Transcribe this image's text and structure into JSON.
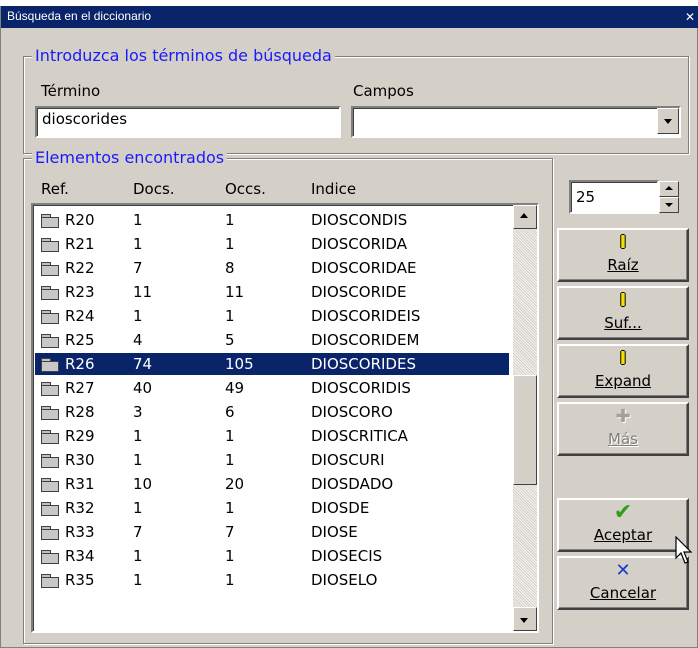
{
  "window": {
    "title": "Búsqueda en el diccionario",
    "close_glyph": "✕"
  },
  "search_group": {
    "legend": "Introduzca los términos de búsqueda",
    "term_label": "Término",
    "term_value": "dioscorides",
    "fields_label": "Campos",
    "fields_value": ""
  },
  "results_group": {
    "legend": "Elementos encontrados",
    "columns": [
      "Ref.",
      "Docs.",
      "Occs.",
      "Indice"
    ],
    "rows": [
      {
        "ref": "R20",
        "docs": "1",
        "occs": "1",
        "indice": "DIOSCONDIS"
      },
      {
        "ref": "R21",
        "docs": "1",
        "occs": "1",
        "indice": "DIOSCORIDA"
      },
      {
        "ref": "R22",
        "docs": "7",
        "occs": "8",
        "indice": "DIOSCORIDAE"
      },
      {
        "ref": "R23",
        "docs": "11",
        "occs": "11",
        "indice": "DIOSCORIDE"
      },
      {
        "ref": "R24",
        "docs": "1",
        "occs": "1",
        "indice": "DIOSCORIDEIS"
      },
      {
        "ref": "R25",
        "docs": "4",
        "occs": "5",
        "indice": "DIOSCORIDEM"
      },
      {
        "ref": "R26",
        "docs": "74",
        "occs": "105",
        "indice": "DIOSCORIDES"
      },
      {
        "ref": "R27",
        "docs": "40",
        "occs": "49",
        "indice": "DIOSCORIDIS"
      },
      {
        "ref": "R28",
        "docs": "3",
        "occs": "6",
        "indice": "DIOSCORO"
      },
      {
        "ref": "R29",
        "docs": "1",
        "occs": "1",
        "indice": "DIOSCRITICA"
      },
      {
        "ref": "R30",
        "docs": "1",
        "occs": "1",
        "indice": "DIOSCURI"
      },
      {
        "ref": "R31",
        "docs": "10",
        "occs": "20",
        "indice": "DIOSDADO"
      },
      {
        "ref": "R32",
        "docs": "1",
        "occs": "1",
        "indice": "DIOSDE"
      },
      {
        "ref": "R33",
        "docs": "7",
        "occs": "7",
        "indice": "DIOSE"
      },
      {
        "ref": "R34",
        "docs": "1",
        "occs": "1",
        "indice": "DIOSECIS"
      },
      {
        "ref": "R35",
        "docs": "1",
        "occs": "1",
        "indice": "DIOSELO"
      }
    ],
    "selected_ref": "R26"
  },
  "spinner": {
    "value": "25"
  },
  "buttons": {
    "raiz": "Raíz",
    "suf": "Suf...",
    "expand": "Expand",
    "mas": "Más",
    "aceptar": "Aceptar",
    "cancelar": "Cancelar"
  },
  "colors": {
    "titlebar": "#0a246a",
    "selection": "#0a246a",
    "group_legend": "#1a1aff",
    "face": "#d4d0c8",
    "accept_check": "#2e9e1a",
    "cancel_x": "#1a3cc8"
  },
  "icons": [
    "folder-icon",
    "check-icon",
    "x-icon",
    "plus-icon",
    "ibeam-icon",
    "cursor-arrow-icon",
    "scroll-up-icon",
    "scroll-down-icon",
    "dropdown-arrow-icon"
  ]
}
